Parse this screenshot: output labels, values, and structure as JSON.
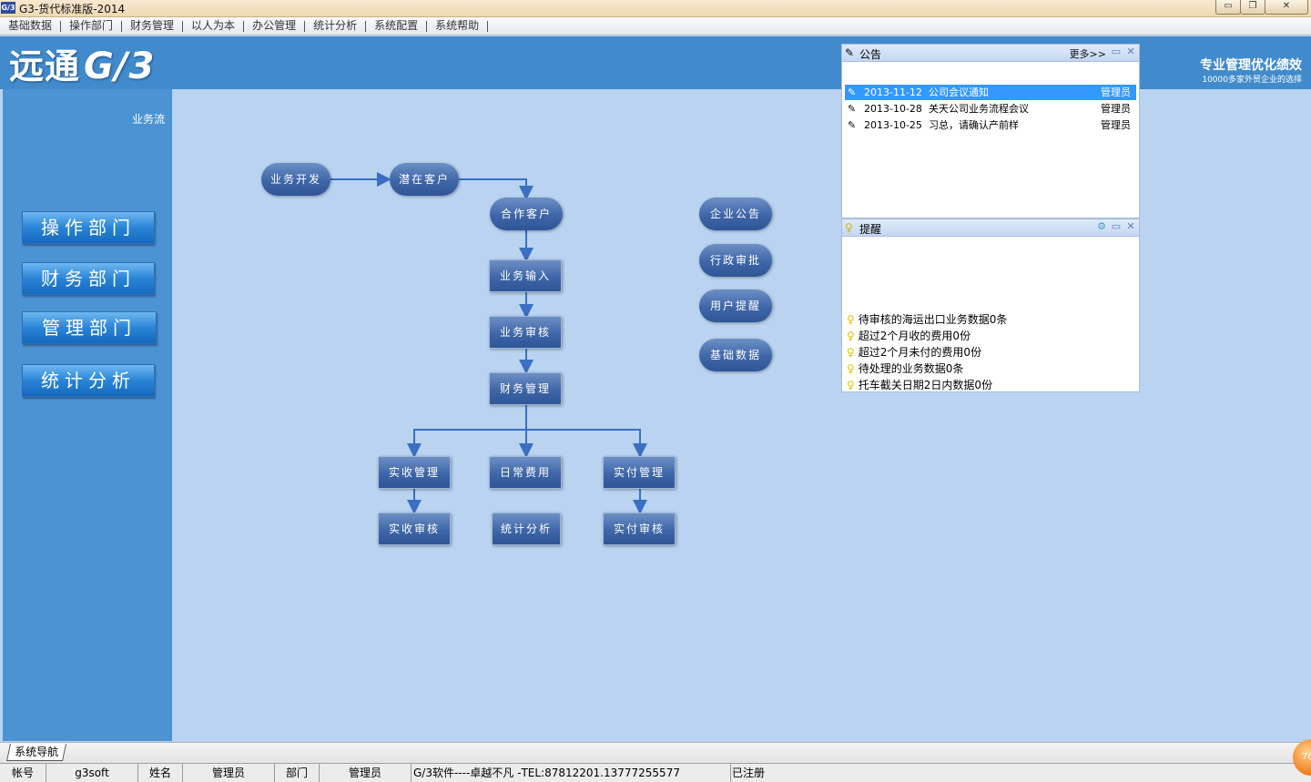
{
  "window": {
    "title": "G3-货代标准版-2014",
    "icon_text": "G/3",
    "min_glyph": "▭",
    "restore_glyph": "❐",
    "close_glyph": "✕"
  },
  "menu": [
    "基础数据",
    "操作部门",
    "财务管理",
    "以人为本",
    "办公管理",
    "统计分析",
    "系统配置",
    "系统帮助"
  ],
  "header": {
    "logo_cn": "远通",
    "logo_g3": "G/3",
    "slogan_main": "专业管理优化绩效",
    "slogan_sub": "10000多家外贸企业的选择"
  },
  "sidebar": {
    "label": "业务流",
    "buttons": [
      "操作部门",
      "财务部门",
      "管理部门",
      "统计分析"
    ]
  },
  "flow": {
    "nodes": [
      "业务开发",
      "潜在客户",
      "合作客户",
      "业务输入",
      "业务审核",
      "财务管理",
      "实收管理",
      "日常费用",
      "实付管理",
      "实收审核",
      "统计分析",
      "实付审核"
    ],
    "quick": [
      "企业公告",
      "行政审批",
      "用户提醒",
      "基础数据"
    ]
  },
  "notice_panel": {
    "title": "公告",
    "more": "更多>>",
    "rows": [
      {
        "date": "2013-11-12",
        "title": "公司会议通知",
        "user": "管理员",
        "selected": true
      },
      {
        "date": "2013-10-28",
        "title": "关天公司业务流程会议",
        "user": "管理员",
        "selected": false
      },
      {
        "date": "2013-10-25",
        "title": "习总，请确认产前样",
        "user": "管理员",
        "selected": false
      }
    ]
  },
  "remind_panel": {
    "title": "提醒",
    "rows": [
      "待审核的海运出口业务数据0条",
      "超过2个月收的费用0份",
      "超过2个月未付的费用0份",
      "待处理的业务数据0条",
      "托车截关日期2日内数据0份"
    ]
  },
  "tabs": {
    "nav": "系统导航"
  },
  "status": {
    "account_label": "帐号",
    "account": "g3soft",
    "name_label": "姓名",
    "name": "管理员",
    "dept_label": "部门",
    "dept": "管理员",
    "company": "G/3软件----卓越不凡 -TEL:87812201.13777255577",
    "registered": "已注册"
  },
  "badge": "78"
}
